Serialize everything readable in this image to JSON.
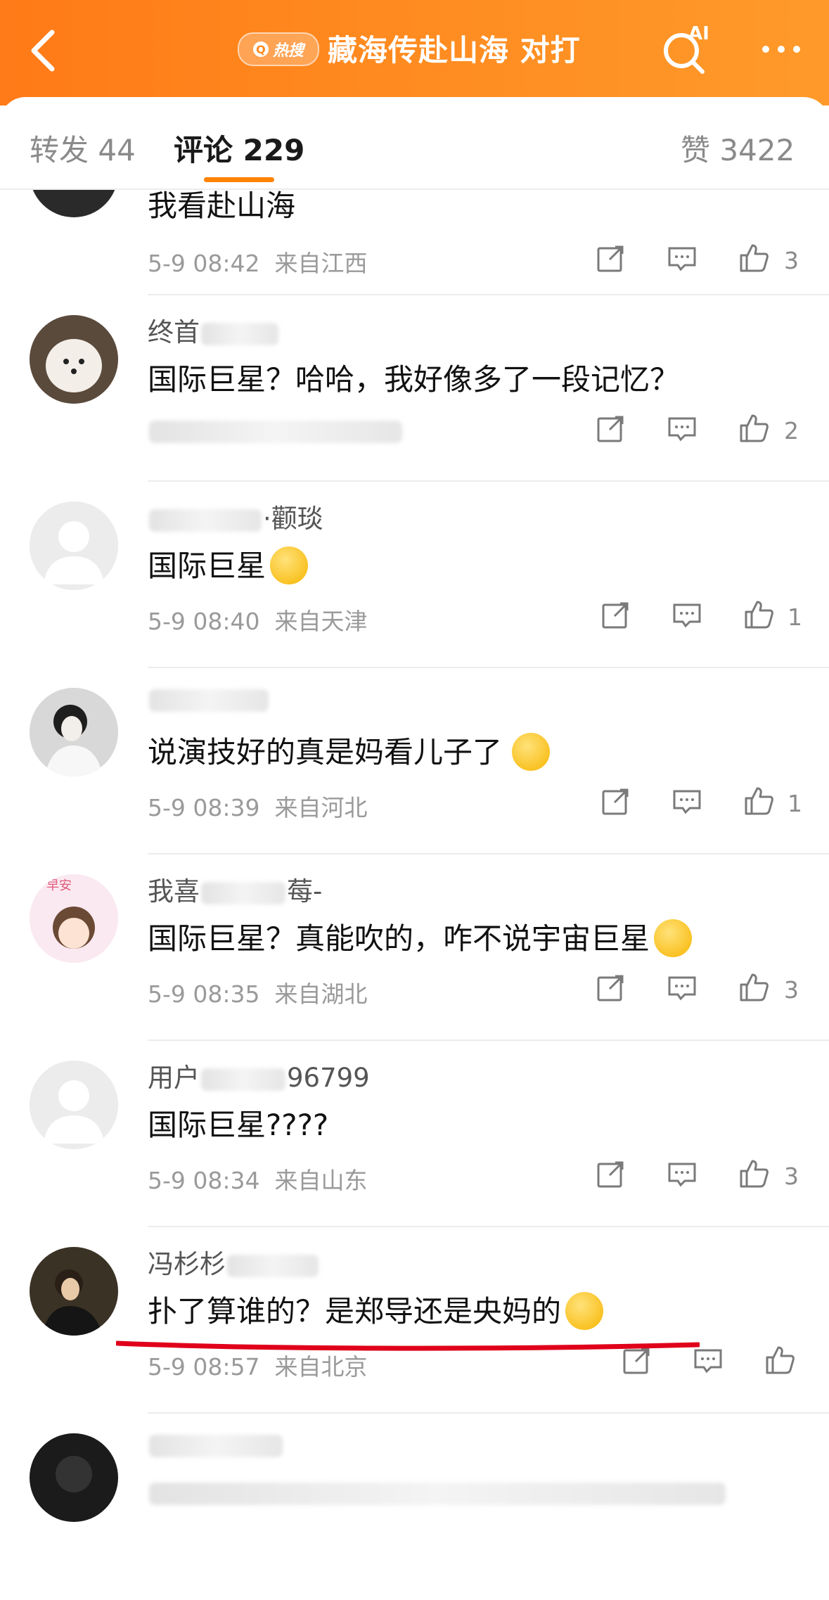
{
  "header": {
    "hot_badge": "热搜",
    "title": "藏海传赴山海 对打",
    "ai_label": "AI"
  },
  "tabs": {
    "repost": "转发 44",
    "comments": "评论 229",
    "likes": "赞 3422"
  },
  "comments": [
    {
      "name_visible": "",
      "text": "我看赴山海",
      "time": "5-9 08:42",
      "location": "来自江西",
      "likes": "3"
    },
    {
      "name_visible": "终首",
      "text": "国际巨星？哈哈，我好像多了一段记忆？",
      "time": "",
      "location": "",
      "likes": "2"
    },
    {
      "name_visible": "·颧琰",
      "text": "国际巨星",
      "time": "5-9 08:40",
      "location": "来自天津",
      "likes": "1"
    },
    {
      "name_visible": "",
      "text": "说演技好的真是妈看儿子了",
      "time": "5-9 08:39",
      "location": "来自河北",
      "likes": "1"
    },
    {
      "name_visible": "我喜",
      "name_suffix": "莓-",
      "text": "国际巨星？真能吹的，咋不说宇宙巨星",
      "time": "5-9 08:35",
      "location": "来自湖北",
      "likes": "3"
    },
    {
      "name_visible": "用户",
      "name_suffix": "96799",
      "text": "国际巨星????",
      "time": "5-9 08:34",
      "location": "来自山东",
      "likes": "3"
    },
    {
      "name_visible": "冯杉杉",
      "text": "扑了算谁的？是郑导还是央妈的",
      "time": "5-9 08:57",
      "location": "来自北京",
      "likes": ""
    },
    {
      "name_visible": "",
      "text": "",
      "time": "",
      "location": "",
      "likes": ""
    }
  ],
  "colors": {
    "header_orange": "#ff8a1f",
    "tab_underline": "#ff8200",
    "annotation_red": "#e0001a"
  }
}
